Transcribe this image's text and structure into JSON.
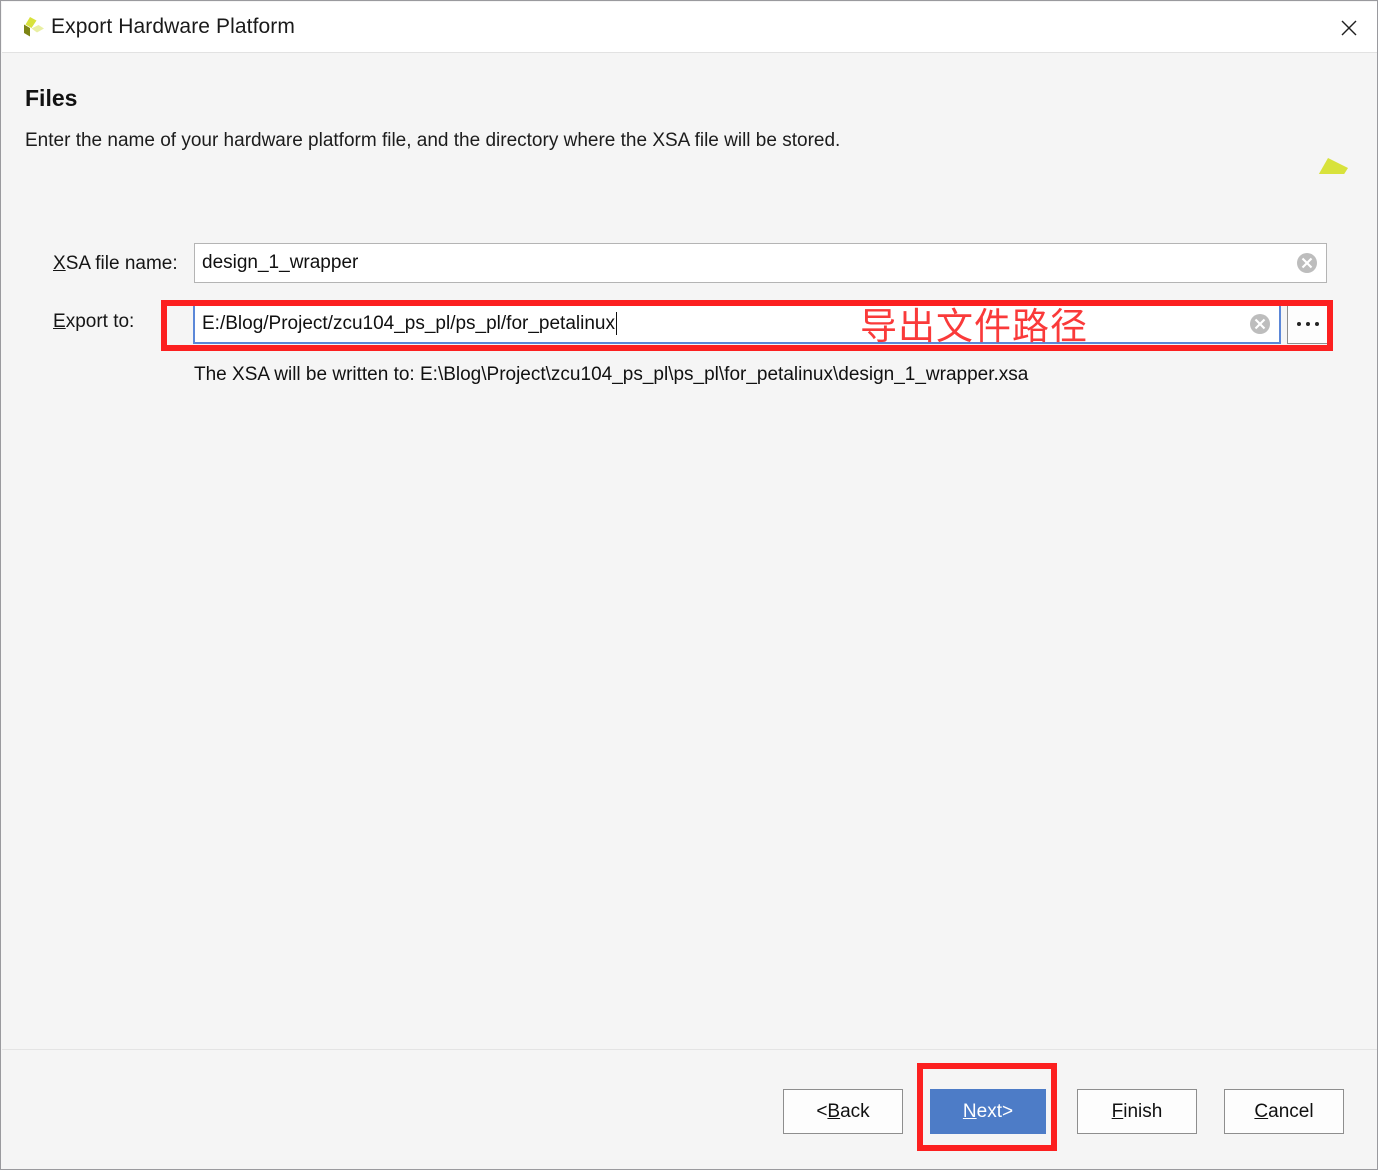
{
  "window": {
    "title": "Export Hardware Platform",
    "app_icon": "xilinx-logo-icon",
    "close_icon": "close-icon"
  },
  "header": {
    "title": "Files",
    "subtitle": "Enter the name of your hardware platform file, and the directory where the XSA file will be stored.",
    "brand_logo": "xilinx-logo-icon",
    "brand_colors": {
      "dark": "#7d8415",
      "bright": "#d8e23c",
      "pale": "#e9efa3"
    }
  },
  "form": {
    "xsa_name": {
      "label_mnemonic": "X",
      "label_rest": "SA file name:",
      "value": "design_1_wrapper",
      "placeholder": "",
      "clear_icon": "clear-circle-icon"
    },
    "export_to": {
      "label_mnemonic": "E",
      "label_rest": "xport to:",
      "value": "E:/Blog/Project/zcu104_ps_pl/ps_pl/for_petalinux",
      "placeholder": "",
      "clear_icon": "clear-circle-icon",
      "browse_label": "...",
      "focused": true
    },
    "hint": "The XSA will be written to: E:\\Blog\\Project\\zcu104_ps_pl\\ps_pl\\for_petalinux\\design_1_wrapper.xsa"
  },
  "annotation": {
    "text": "导出文件路径",
    "color": "#fa3a3a"
  },
  "highlights": {
    "color": "#fc2020",
    "targets": [
      "export-to-input",
      "next-button"
    ]
  },
  "footer": {
    "buttons": [
      {
        "name": "back",
        "prefix": "< ",
        "mnemonic": "B",
        "rest": "ack",
        "suffix": "",
        "primary": false
      },
      {
        "name": "next",
        "prefix": "",
        "mnemonic": "N",
        "rest": "ext",
        "suffix": " >",
        "primary": true
      },
      {
        "name": "finish",
        "prefix": "",
        "mnemonic": "F",
        "rest": "inish",
        "suffix": "",
        "primary": false
      },
      {
        "name": "cancel",
        "prefix": "",
        "mnemonic": "C",
        "rest": "ancel",
        "suffix": "",
        "primary": false
      }
    ],
    "accent_color": "#4d7cc7"
  }
}
